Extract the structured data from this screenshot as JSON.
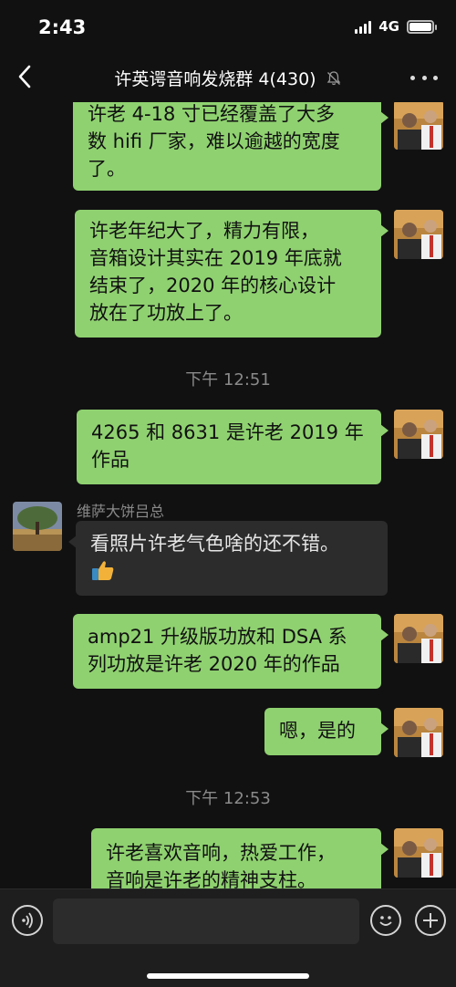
{
  "status": {
    "time": "2:43",
    "network": "4G"
  },
  "header": {
    "title": "许英谔音响发烧群 4(430)"
  },
  "messages": [
    {
      "lines": [
        "许老 4-18 寸已经覆盖了大多",
        "数 hifi 厂家，难以逾越的宽度",
        "了。"
      ]
    },
    {
      "lines": [
        "许老年纪大了，精力有限，",
        "音箱设计其实在 2019 年底就",
        "结束了，2020 年的核心设计",
        "放在了功放上了。"
      ]
    },
    {
      "lines": [
        "4265 和 8631 是许老 2019 年",
        "作品"
      ]
    },
    {
      "sender": "维萨大饼吕总",
      "lines": [
        "看照片许老气色啥的还不错。"
      ]
    },
    {
      "lines": [
        "amp21 升级版功放和 DSA 系",
        "列功放是许老 2020 年的作品"
      ]
    },
    {
      "lines": [
        "嗯，是的"
      ]
    },
    {
      "lines": [
        "许老喜欢音响，热爱工作，",
        "音响是许老的精神支柱。"
      ]
    }
  ],
  "timestamps": [
    "下午 12:51",
    "下午 12:53"
  ],
  "colors": {
    "bubble_mine": "#8fd170",
    "bubble_theirs": "#2c2c2c",
    "background": "#111111"
  },
  "icons": {
    "muted": "bell-slash-icon",
    "thumb": "thumbs-up-emoji"
  }
}
